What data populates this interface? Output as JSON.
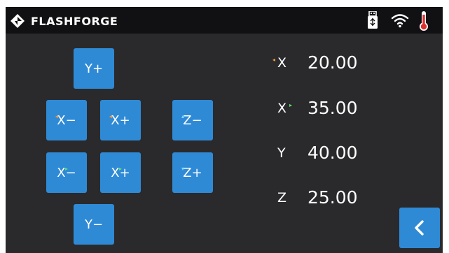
{
  "header": {
    "brand": "FLASHFORGE",
    "logo_icon": "flashforge-diamond-logo",
    "status_icons": [
      "usb-drive-icon",
      "wifi-icon",
      "thermometer-icon"
    ],
    "thermometer_color": "#e0302c"
  },
  "jog": {
    "y_plus": "Y+",
    "y_minus": "Y−",
    "x_minus": "X−",
    "x_plus": "X+",
    "x2_minus": "X−",
    "x2_plus": "X+",
    "z_minus": "Z−",
    "z_plus": "Z+"
  },
  "coordinates": [
    {
      "axis": "X",
      "value": "20.00"
    },
    {
      "axis": "X",
      "value": "35.00"
    },
    {
      "axis": "Y",
      "value": "40.00"
    },
    {
      "axis": "Z",
      "value": "25.00"
    }
  ],
  "colors": {
    "background": "#2a2a2c",
    "header": "#111113",
    "button": "#2f8ad6",
    "extruder_left_marker": "#ff9a3c",
    "extruder_right_marker": "#5ee06a"
  },
  "back_icon": "chevron-left-icon"
}
